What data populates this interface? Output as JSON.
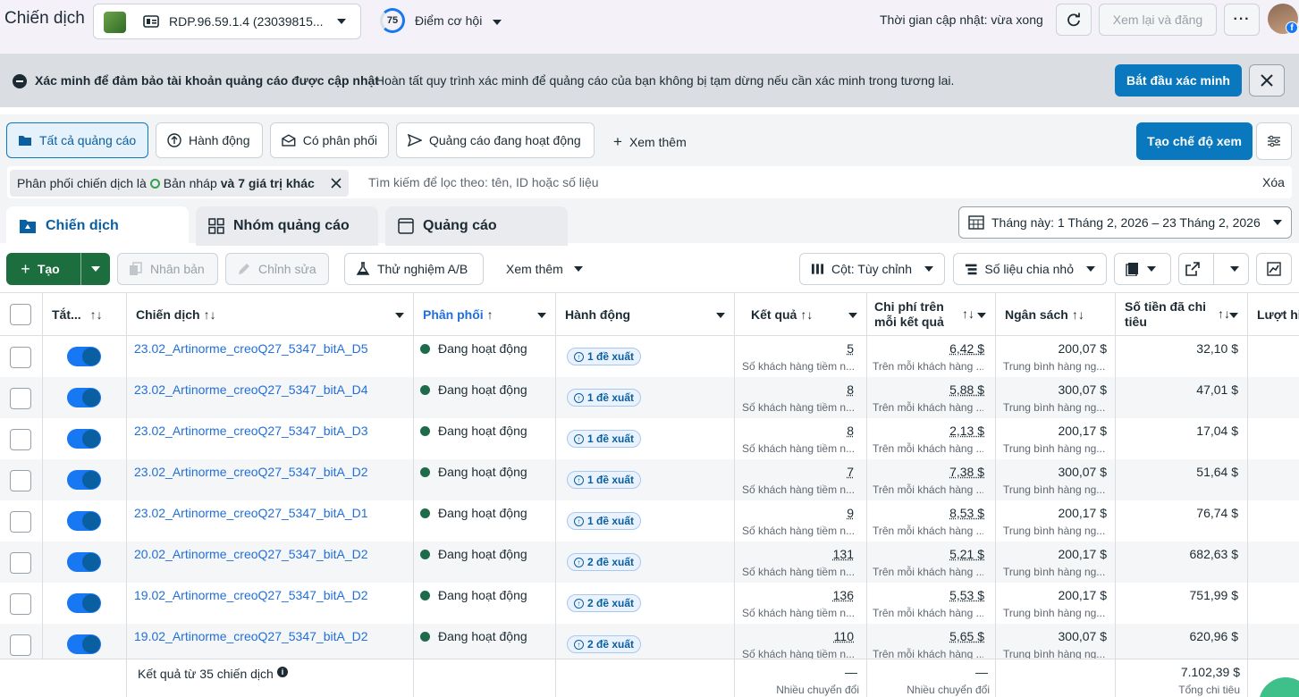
{
  "header": {
    "title": "Chiến dịch",
    "account_name": "RDP.96.59.1.4 (23039815...",
    "score_value": "75",
    "score_label": "Điểm cơ hội",
    "update_time": "Thời gian cập nhật: vừa xong",
    "review_publish": "Xem lại và đăng"
  },
  "banner": {
    "title": "Xác minh để đảm bảo tài khoản quảng cáo được cập nhật",
    "text": "Hoàn tất quy trình xác minh để quảng cáo của bạn không bị tạm dừng nếu cần xác minh trong tương lai.",
    "action": "Bắt đầu xác minh"
  },
  "filters": {
    "chips": [
      "Tất cả quảng cáo",
      "Hành động",
      "Có phân phối",
      "Quảng cáo đang hoạt động"
    ],
    "see_more": "Xem thêm",
    "create_view": "Tạo chế độ xem",
    "token_prefix": "Phân phối chiến dịch là",
    "token_value": "Bản nháp",
    "token_suffix": "và 7 giá trị khác",
    "search_placeholder": "Tìm kiếm để lọc theo: tên, ID hoặc số liệu",
    "clear": "Xóa"
  },
  "tabs": [
    "Chiến dịch",
    "Nhóm quảng cáo",
    "Quảng cáo"
  ],
  "date_range": "Tháng này: 1 Tháng 2, 2026 – 23 Tháng 2, 2026",
  "toolbar": {
    "create": "Tạo",
    "duplicate": "Nhân bản",
    "edit": "Chỉnh sửa",
    "ab_test": "Thử nghiệm A/B",
    "see_more": "Xem thêm",
    "columns": "Cột: Tùy chỉnh",
    "breakdown": "Số liệu chia nhỏ"
  },
  "columns": {
    "toggle": "Tắt...",
    "campaign": "Chiến dịch",
    "delivery": "Phân phối",
    "actions": "Hành động",
    "results": "Kết quả",
    "cost_per_result": "Chi phí trên mỗi kết quả",
    "budget": "Ngân sách",
    "amount_spent": "Số tiền đã chi tiêu",
    "reach": "Lượt hi"
  },
  "rows": [
    {
      "name": "23.02_Artinorme_creoQ27_5347_bitA_D5",
      "status": "Đang hoạt động",
      "suggestion": "1 đề xuất",
      "results": "5",
      "results_sub": "Số khách hàng tiềm n...",
      "cpr": "6,42 $",
      "cpr_sub": "Trên mỗi khách hàng ...",
      "budget": "200,07 $",
      "budget_sub": "Trung bình hàng ng...",
      "spent": "32,10 $"
    },
    {
      "name": "23.02_Artinorme_creoQ27_5347_bitA_D4",
      "status": "Đang hoạt động",
      "suggestion": "1 đề xuất",
      "results": "8",
      "results_sub": "Số khách hàng tiềm n...",
      "cpr": "5,88 $",
      "cpr_sub": "Trên mỗi khách hàng ...",
      "budget": "300,07 $",
      "budget_sub": "Trung bình hàng ng...",
      "spent": "47,01 $"
    },
    {
      "name": "23.02_Artinorme_creoQ27_5347_bitA_D3",
      "status": "Đang hoạt động",
      "suggestion": "1 đề xuất",
      "results": "8",
      "results_sub": "Số khách hàng tiềm n...",
      "cpr": "2,13 $",
      "cpr_sub": "Trên mỗi khách hàng ...",
      "budget": "200,17 $",
      "budget_sub": "Trung bình hàng ng...",
      "spent": "17,04 $"
    },
    {
      "name": "23.02_Artinorme_creoQ27_5347_bitA_D2",
      "status": "Đang hoạt động",
      "suggestion": "1 đề xuất",
      "results": "7",
      "results_sub": "Số khách hàng tiềm n...",
      "cpr": "7,38 $",
      "cpr_sub": "Trên mỗi khách hàng ...",
      "budget": "300,07 $",
      "budget_sub": "Trung bình hàng ng...",
      "spent": "51,64 $"
    },
    {
      "name": "23.02_Artinorme_creoQ27_5347_bitA_D1",
      "status": "Đang hoạt động",
      "suggestion": "1 đề xuất",
      "results": "9",
      "results_sub": "Số khách hàng tiềm n...",
      "cpr": "8,53 $",
      "cpr_sub": "Trên mỗi khách hàng ...",
      "budget": "200,17 $",
      "budget_sub": "Trung bình hàng ng...",
      "spent": "76,74 $"
    },
    {
      "name": "20.02_Artinorme_creoQ27_5347_bitA_D2",
      "status": "Đang hoạt động",
      "suggestion": "2 đề xuất",
      "results": "131",
      "results_sub": "Số khách hàng tiềm n...",
      "cpr": "5,21 $",
      "cpr_sub": "Trên mỗi khách hàng ...",
      "budget": "200,17 $",
      "budget_sub": "Trung bình hàng ng...",
      "spent": "682,63 $"
    },
    {
      "name": "19.02_Artinorme_creoQ27_5347_bitA_D2",
      "status": "Đang hoạt động",
      "suggestion": "2 đề xuất",
      "results": "136",
      "results_sub": "Số khách hàng tiềm n...",
      "cpr": "5,53 $",
      "cpr_sub": "Trên mỗi khách hàng ...",
      "budget": "200,17 $",
      "budget_sub": "Trung bình hàng ng...",
      "spent": "751,99 $"
    },
    {
      "name": "19.02_Artinorme_creoQ27_5347_bitA_D2",
      "status": "Đang hoạt động",
      "suggestion": "2 đề xuất",
      "results": "110",
      "results_sub": "Số khách hàng tiềm n...",
      "cpr": "5,65 $",
      "cpr_sub": "Trên mỗi khách hàng ...",
      "budget": "300,07 $",
      "budget_sub": "Trung bình hàng ng...",
      "spent": "620,96 $"
    }
  ],
  "footer": {
    "label": "Kết quả từ 35 chiến dịch",
    "results": "—",
    "results_sub": "Nhiều chuyển đổi",
    "cpr": "—",
    "cpr_sub": "Nhiều chuyển đổi",
    "spent": "7.102,39 $",
    "spent_sub": "Tổng chi tiêu"
  },
  "colors": {
    "accent": "#0a78be",
    "create_green": "#1c6e3e",
    "link": "#216fdb",
    "active_dot": "#1e6b4c"
  }
}
